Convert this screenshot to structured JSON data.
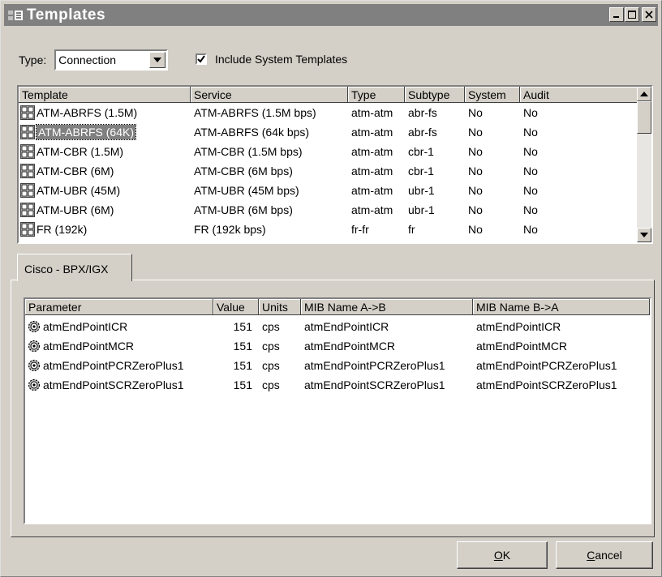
{
  "window": {
    "title": "Templates",
    "icon": "templates-app-icon",
    "buttons": [
      "minimize-icon",
      "maximize-icon",
      "close-icon"
    ]
  },
  "filter": {
    "type_label": "Type:",
    "type_value": "Connection",
    "include_system_label": "Include System Templates",
    "include_system_checked": true
  },
  "templates_table": {
    "columns": [
      "Template",
      "Service",
      "Type",
      "Subtype",
      "System",
      "Audit"
    ],
    "selected_index": 1,
    "rows": [
      {
        "template": "ATM-ABRFS (1.5M)",
        "service": "ATM-ABRFS (1.5M bps)",
        "type": "atm-atm",
        "subtype": "abr-fs",
        "system": "No",
        "audit": "No"
      },
      {
        "template": "ATM-ABRFS (64K)",
        "service": "ATM-ABRFS (64k bps)",
        "type": "atm-atm",
        "subtype": "abr-fs",
        "system": "No",
        "audit": "No"
      },
      {
        "template": "ATM-CBR (1.5M)",
        "service": "ATM-CBR (1.5M bps)",
        "type": "atm-atm",
        "subtype": "cbr-1",
        "system": "No",
        "audit": "No"
      },
      {
        "template": "ATM-CBR (6M)",
        "service": "ATM-CBR (6M bps)",
        "type": "atm-atm",
        "subtype": "cbr-1",
        "system": "No",
        "audit": "No"
      },
      {
        "template": "ATM-UBR (45M)",
        "service": "ATM-UBR (45M bps)",
        "type": "atm-atm",
        "subtype": "ubr-1",
        "system": "No",
        "audit": "No"
      },
      {
        "template": "ATM-UBR (6M)",
        "service": "ATM-UBR (6M bps)",
        "type": "atm-atm",
        "subtype": "ubr-1",
        "system": "No",
        "audit": "No"
      },
      {
        "template": "FR (192k)",
        "service": "FR (192k bps)",
        "type": "fr-fr",
        "subtype": "fr",
        "system": "No",
        "audit": "No"
      }
    ]
  },
  "tab": {
    "label": "Cisco - BPX/IGX"
  },
  "parameters_table": {
    "columns": [
      "Parameter",
      "Value",
      "Units",
      "MIB Name A->B",
      "MIB Name B->A"
    ],
    "rows": [
      {
        "parameter": "atmEndPointICR",
        "value": "151",
        "units": "cps",
        "mib_ab": "atmEndPointICR",
        "mib_ba": "atmEndPointICR"
      },
      {
        "parameter": "atmEndPointMCR",
        "value": "151",
        "units": "cps",
        "mib_ab": "atmEndPointMCR",
        "mib_ba": "atmEndPointMCR"
      },
      {
        "parameter": "atmEndPointPCRZeroPlus1",
        "value": "151",
        "units": "cps",
        "mib_ab": "atmEndPointPCRZeroPlus1",
        "mib_ba": "atmEndPointPCRZeroPlus1"
      },
      {
        "parameter": "atmEndPointSCRZeroPlus1",
        "value": "151",
        "units": "cps",
        "mib_ab": "atmEndPointSCRZeroPlus1",
        "mib_ba": "atmEndPointSCRZeroPlus1"
      }
    ]
  },
  "buttons": {
    "ok_accel": "O",
    "ok_rest": "K",
    "cancel_accel": "C",
    "cancel_rest": "ancel"
  },
  "colors": {
    "face": "#d4d0c8",
    "titlebar": "#808080",
    "selection": "#808080"
  }
}
